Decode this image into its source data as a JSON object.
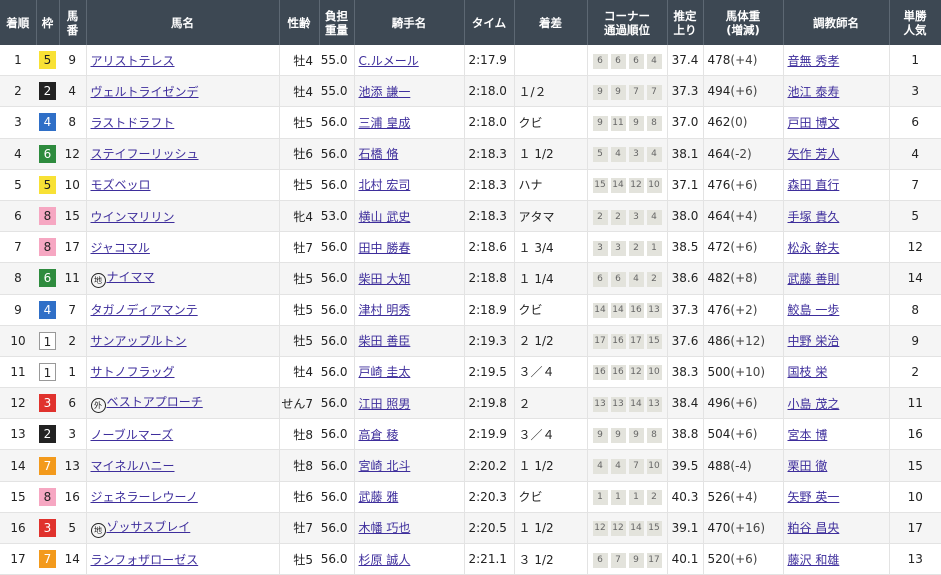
{
  "headers": {
    "rank": "着順",
    "waku": "枠",
    "umaban": [
      "馬",
      "番"
    ],
    "horse": "馬名",
    "sex_age": "性齢",
    "weight": [
      "負担",
      "重量"
    ],
    "jockey": "騎手名",
    "time": "タイム",
    "margin": "着差",
    "corner": [
      "コーナー",
      "通過順位"
    ],
    "last3f": [
      "推定",
      "上り"
    ],
    "body": [
      "馬体重",
      "(増減)"
    ],
    "trainer": "調教師名",
    "pop": [
      "単勝",
      "人気"
    ]
  },
  "colors": {
    "header_bg": "#3d4853",
    "link": "#3e2e9c",
    "row_alt": "#f5f5f5"
  },
  "rows": [
    {
      "rank": "1",
      "waku": "5",
      "umaban": "9",
      "mark": "",
      "horse": "アリストテレス",
      "sex_age": "牡4",
      "weight": "55.0",
      "jockey": "C.ルメール",
      "time": "2:17.9",
      "margin": "",
      "corner": [
        "6",
        "6",
        "6",
        "4"
      ],
      "last3f": "37.4",
      "body": "478",
      "diff": "(+4)",
      "trainer": "音無 秀孝",
      "pop": "1"
    },
    {
      "rank": "2",
      "waku": "2",
      "umaban": "4",
      "mark": "",
      "horse": "ヴェルトライゼンデ",
      "sex_age": "牡4",
      "weight": "55.0",
      "jockey": "池添 謙一",
      "time": "2:18.0",
      "margin": "１/２",
      "corner": [
        "9",
        "9",
        "7",
        "7"
      ],
      "last3f": "37.3",
      "body": "494",
      "diff": "(+6)",
      "trainer": "池江 泰寿",
      "pop": "3"
    },
    {
      "rank": "3",
      "waku": "4",
      "umaban": "8",
      "mark": "",
      "horse": "ラストドラフト",
      "sex_age": "牡5",
      "weight": "56.0",
      "jockey": "三浦 皇成",
      "time": "2:18.0",
      "margin": "クビ",
      "corner": [
        "9",
        "11",
        "9",
        "8"
      ],
      "last3f": "37.0",
      "body": "462",
      "diff": "(0)",
      "trainer": "戸田 博文",
      "pop": "6"
    },
    {
      "rank": "4",
      "waku": "6",
      "umaban": "12",
      "mark": "",
      "horse": "ステイフーリッシュ",
      "sex_age": "牡6",
      "weight": "56.0",
      "jockey": "石橋 脩",
      "time": "2:18.3",
      "margin": "１ 1/2",
      "corner": [
        "5",
        "4",
        "3",
        "4"
      ],
      "last3f": "38.1",
      "body": "464",
      "diff": "(-2)",
      "trainer": "矢作 芳人",
      "pop": "4"
    },
    {
      "rank": "5",
      "waku": "5",
      "umaban": "10",
      "mark": "",
      "horse": "モズベッロ",
      "sex_age": "牡5",
      "weight": "56.0",
      "jockey": "北村 宏司",
      "time": "2:18.3",
      "margin": "ハナ",
      "corner": [
        "15",
        "14",
        "12",
        "10"
      ],
      "last3f": "37.1",
      "body": "476",
      "diff": "(+6)",
      "trainer": "森田 直行",
      "pop": "7"
    },
    {
      "rank": "6",
      "waku": "8",
      "umaban": "15",
      "mark": "",
      "horse": "ウインマリリン",
      "sex_age": "牝4",
      "weight": "53.0",
      "jockey": "横山 武史",
      "time": "2:18.3",
      "margin": "アタマ",
      "corner": [
        "2",
        "2",
        "3",
        "4"
      ],
      "last3f": "38.0",
      "body": "464",
      "diff": "(+4)",
      "trainer": "手塚 貴久",
      "pop": "5"
    },
    {
      "rank": "7",
      "waku": "8",
      "umaban": "17",
      "mark": "",
      "horse": "ジャコマル",
      "sex_age": "牡7",
      "weight": "56.0",
      "jockey": "田中 勝春",
      "time": "2:18.6",
      "margin": "１ 3/4",
      "corner": [
        "3",
        "3",
        "2",
        "1"
      ],
      "last3f": "38.5",
      "body": "472",
      "diff": "(+6)",
      "trainer": "松永 幹夫",
      "pop": "12"
    },
    {
      "rank": "8",
      "waku": "6",
      "umaban": "11",
      "mark": "地",
      "horse": "ナイママ",
      "sex_age": "牡5",
      "weight": "56.0",
      "jockey": "柴田 大知",
      "time": "2:18.8",
      "margin": "１ 1/4",
      "corner": [
        "6",
        "6",
        "4",
        "2"
      ],
      "last3f": "38.6",
      "body": "482",
      "diff": "(+8)",
      "trainer": "武藤 善則",
      "pop": "14"
    },
    {
      "rank": "9",
      "waku": "4",
      "umaban": "7",
      "mark": "",
      "horse": "タガノディアマンテ",
      "sex_age": "牡5",
      "weight": "56.0",
      "jockey": "津村 明秀",
      "time": "2:18.9",
      "margin": "クビ",
      "corner": [
        "14",
        "14",
        "16",
        "13"
      ],
      "last3f": "37.3",
      "body": "476",
      "diff": "(+2)",
      "trainer": "鮫島 一歩",
      "pop": "8"
    },
    {
      "rank": "10",
      "waku": "1",
      "umaban": "2",
      "mark": "",
      "horse": "サンアップルトン",
      "sex_age": "牡5",
      "weight": "56.0",
      "jockey": "柴田 善臣",
      "time": "2:19.3",
      "margin": "２ 1/2",
      "corner": [
        "17",
        "16",
        "17",
        "15"
      ],
      "last3f": "37.6",
      "body": "486",
      "diff": "(+12)",
      "trainer": "中野 栄治",
      "pop": "9"
    },
    {
      "rank": "11",
      "waku": "1",
      "umaban": "1",
      "mark": "",
      "horse": "サトノフラッグ",
      "sex_age": "牡4",
      "weight": "56.0",
      "jockey": "戸崎 圭太",
      "time": "2:19.5",
      "margin": "３／４",
      "corner": [
        "16",
        "16",
        "12",
        "10"
      ],
      "last3f": "38.3",
      "body": "500",
      "diff": "(+10)",
      "trainer": "国枝 栄",
      "pop": "2"
    },
    {
      "rank": "12",
      "waku": "3",
      "umaban": "6",
      "mark": "外",
      "horse": "ベストアプローチ",
      "sex_age": "せん7",
      "weight": "56.0",
      "jockey": "江田 照男",
      "time": "2:19.8",
      "margin": "２",
      "corner": [
        "13",
        "13",
        "14",
        "13"
      ],
      "last3f": "38.4",
      "body": "496",
      "diff": "(+6)",
      "trainer": "小島 茂之",
      "pop": "11"
    },
    {
      "rank": "13",
      "waku": "2",
      "umaban": "3",
      "mark": "",
      "horse": "ノーブルマーズ",
      "sex_age": "牡8",
      "weight": "56.0",
      "jockey": "高倉 稜",
      "time": "2:19.9",
      "margin": "３／４",
      "corner": [
        "9",
        "9",
        "9",
        "8"
      ],
      "last3f": "38.8",
      "body": "504",
      "diff": "(+6)",
      "trainer": "宮本 博",
      "pop": "16"
    },
    {
      "rank": "14",
      "waku": "7",
      "umaban": "13",
      "mark": "",
      "horse": "マイネルハニー",
      "sex_age": "牡8",
      "weight": "56.0",
      "jockey": "宮崎 北斗",
      "time": "2:20.2",
      "margin": "１ 1/2",
      "corner": [
        "4",
        "4",
        "7",
        "10"
      ],
      "last3f": "39.5",
      "body": "488",
      "diff": "(-4)",
      "trainer": "栗田 徹",
      "pop": "15"
    },
    {
      "rank": "15",
      "waku": "8",
      "umaban": "16",
      "mark": "",
      "horse": "ジェネラーレウーノ",
      "sex_age": "牡6",
      "weight": "56.0",
      "jockey": "武藤 雅",
      "time": "2:20.3",
      "margin": "クビ",
      "corner": [
        "1",
        "1",
        "1",
        "2"
      ],
      "last3f": "40.3",
      "body": "526",
      "diff": "(+4)",
      "trainer": "矢野 英一",
      "pop": "10"
    },
    {
      "rank": "16",
      "waku": "3",
      "umaban": "5",
      "mark": "地",
      "horse": "ゾッサスブレイ",
      "sex_age": "牡7",
      "weight": "56.0",
      "jockey": "木幡 巧也",
      "time": "2:20.5",
      "margin": "１ 1/2",
      "corner": [
        "12",
        "12",
        "14",
        "15"
      ],
      "last3f": "39.1",
      "body": "470",
      "diff": "(+16)",
      "trainer": "粕谷 昌央",
      "pop": "17"
    },
    {
      "rank": "17",
      "waku": "7",
      "umaban": "14",
      "mark": "",
      "horse": "ランフォザローゼス",
      "sex_age": "牡5",
      "weight": "56.0",
      "jockey": "杉原 誠人",
      "time": "2:21.1",
      "margin": "３ 1/2",
      "corner": [
        "6",
        "7",
        "9",
        "17"
      ],
      "last3f": "40.1",
      "body": "520",
      "diff": "(+6)",
      "trainer": "藤沢 和雄",
      "pop": "13"
    }
  ]
}
